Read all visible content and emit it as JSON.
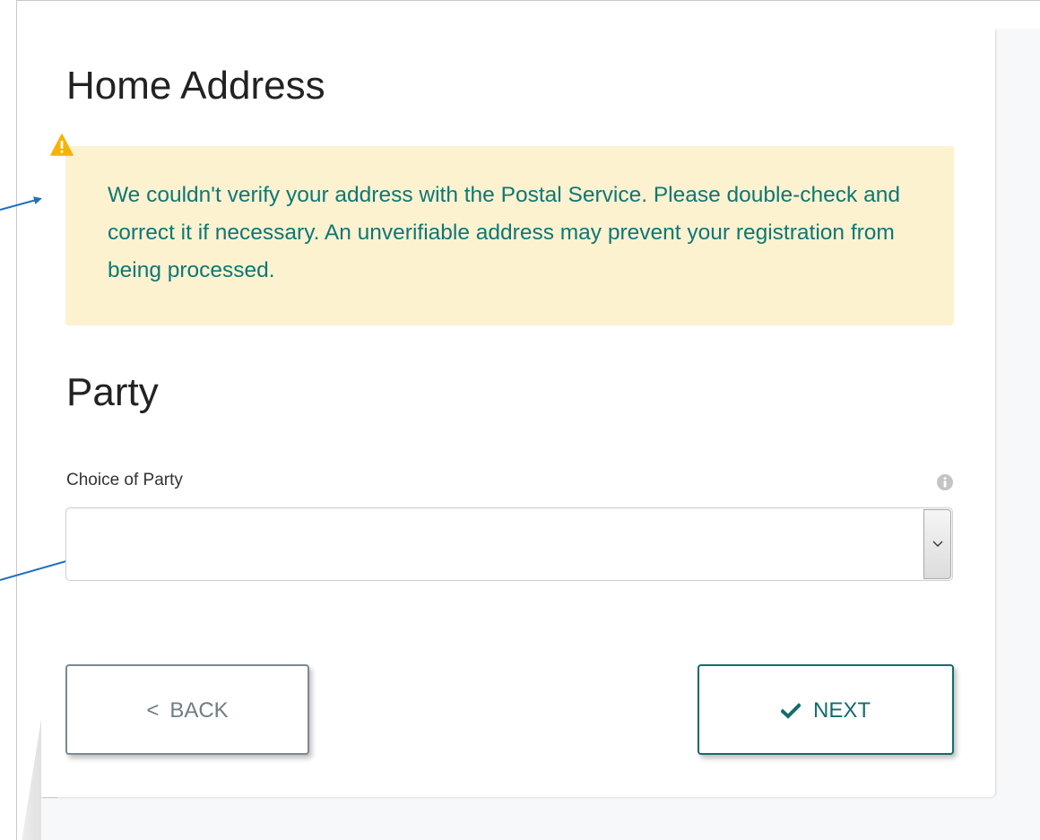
{
  "home_address": {
    "heading": "Home Address",
    "alert_message": "We couldn't verify your address with the Postal Service. Please double-check and correct it if necessary. An unverifiable address may prevent your registration from being processed.",
    "alert_icon": "warning-icon"
  },
  "party": {
    "heading": "Party",
    "field_label": "Choice of Party",
    "info_icon": "info-icon",
    "selected_value": ""
  },
  "buttons": {
    "back_glyph": "<",
    "back_label": "BACK",
    "next_icon": "checkmark-icon",
    "next_label": "NEXT"
  },
  "colors": {
    "alert_background": "#fdf2cf",
    "alert_text": "#0d7778",
    "primary_teal": "#146b6e",
    "annotation_arrow": "#1f6fbf",
    "warning_yellow": "#f5b400"
  }
}
